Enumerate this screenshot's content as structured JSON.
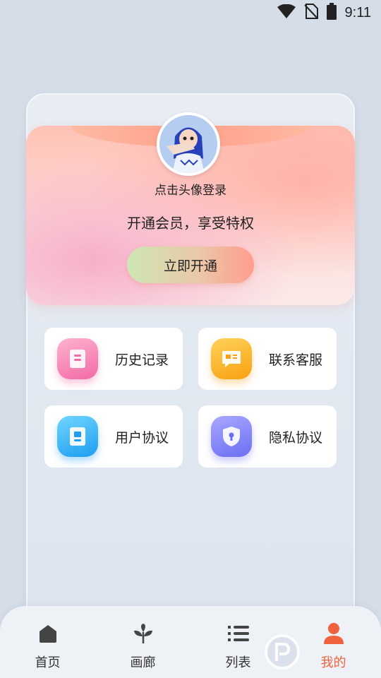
{
  "status_bar": {
    "time": "9:11",
    "icons": [
      "wifi-icon",
      "no-sim-icon",
      "battery-icon"
    ]
  },
  "profile": {
    "login_prompt": "点击头像登录",
    "vip_slogan": "开通会员，享受特权",
    "open_button": "立即开通"
  },
  "menu": {
    "items": [
      {
        "label": "历史记录",
        "icon": "history-book-icon",
        "color": "#f26aa5"
      },
      {
        "label": "联系客服",
        "icon": "customer-service-icon",
        "color": "#f8a010"
      },
      {
        "label": "用户协议",
        "icon": "user-agreement-icon",
        "color": "#1d9df0"
      },
      {
        "label": "隐私协议",
        "icon": "privacy-shield-icon",
        "color": "#6b6ef2"
      }
    ]
  },
  "bottom_nav": {
    "items": [
      {
        "label": "首页",
        "icon": "home-icon"
      },
      {
        "label": "画廊",
        "icon": "sprout-icon"
      },
      {
        "label": "列表",
        "icon": "list-icon"
      },
      {
        "label": "我的",
        "icon": "user-icon",
        "active": true
      }
    ],
    "active_color": "#f0623e"
  }
}
